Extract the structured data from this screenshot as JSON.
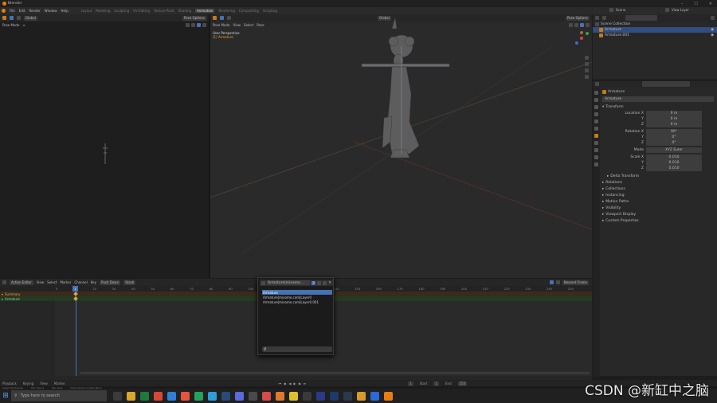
{
  "window": {
    "title": "Blender"
  },
  "menubar": {
    "menus": [
      "File",
      "Edit",
      "Render",
      "Window",
      "Help"
    ],
    "workspaces": [
      "Layout",
      "Modeling",
      "Sculpting",
      "UV Editing",
      "Texture Paint",
      "Shading",
      "Animation",
      "Rendering",
      "Compositing",
      "Scripting"
    ],
    "active_workspace": "Animation",
    "scene": "Scene",
    "view_layer": "View Layer"
  },
  "left_viewport": {
    "mode": "Pose Mode",
    "orientation": "Global",
    "options": "Pose Options"
  },
  "main_viewport": {
    "mode": "Pose Mode",
    "menus": [
      "View",
      "Select",
      "Pose"
    ],
    "orientation": "Global",
    "options": "Pose Options",
    "overlay_title": "User Perspective",
    "overlay_sub": "(1) Armature"
  },
  "outliner": {
    "items": [
      {
        "label": "Scene Collection"
      },
      {
        "label": "Armature"
      },
      {
        "label": "Armature.001"
      }
    ]
  },
  "properties": {
    "object_name": "Armature",
    "header": "Armature",
    "transform_label": "Transform",
    "location": {
      "label": "Location X",
      "values": [
        "0 m",
        "0 m",
        "0 m"
      ],
      "axes": [
        "Y",
        "Z"
      ]
    },
    "rotation": {
      "label": "Rotation X",
      "values": [
        "90°",
        "0°",
        "0°"
      ],
      "axes": [
        "Y",
        "Z"
      ]
    },
    "mode": {
      "label": "Mode",
      "value": "XYZ Euler"
    },
    "scale": {
      "label": "Scale X",
      "values": [
        "0.010",
        "0.010",
        "0.010"
      ],
      "axes": [
        "Y",
        "Z"
      ]
    },
    "collapsed_sections": [
      "Delta Transform",
      "Relations",
      "Collections",
      "Instancing",
      "Motion Paths",
      "Visibility",
      "Viewport Display",
      "Custom Properties"
    ]
  },
  "dope_sheet": {
    "editor": "Action Editor",
    "menus": [
      "View",
      "Select",
      "Marker",
      "Channel",
      "Key"
    ],
    "push_down": "Push Down",
    "stash": "Stash",
    "interpolation": "Nearest Frame",
    "channels": [
      "Summary",
      "Armature"
    ],
    "ruler_ticks": [
      "0",
      "10",
      "20",
      "30",
      "40",
      "50",
      "60",
      "70",
      "80",
      "90",
      "100",
      "110",
      "120",
      "130",
      "140",
      "150",
      "160",
      "170",
      "180",
      "190",
      "200",
      "210",
      "220",
      "230",
      "240",
      "250"
    ]
  },
  "popup": {
    "field_value": "Armature|mixamo...",
    "user_count": "2",
    "items": [
      "Armature",
      "Armature|mixamo.com|Layer0",
      "Armature|mixamo.com|Layer0.001"
    ],
    "selected_index": 0
  },
  "timeline": {
    "playback": "Playback",
    "keying": "Keying",
    "view": "View",
    "marker": "Marker",
    "current_frame": "1",
    "start": "Start",
    "start_value": "1",
    "end": "End",
    "end_value": "250"
  },
  "statusbar": {
    "left": "Select Keyframes",
    "mid1": "Box Select",
    "mid2": "Pan View",
    "context": "Dope Sheet Context Menu"
  },
  "taskbar": {
    "search_placeholder": "Type here to search",
    "time": "",
    "date": ""
  },
  "watermark": {
    "text": "CSDN @新缸中之脑"
  }
}
